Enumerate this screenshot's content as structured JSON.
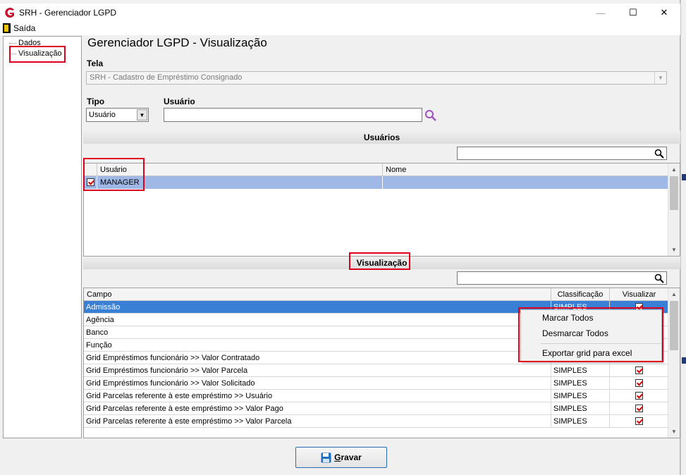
{
  "window": {
    "title": "SRH - Gerenciador LGPD",
    "minimize_glyph": "—",
    "maximize_glyph": "☐",
    "close_glyph": "✕"
  },
  "menu": {
    "exit_label": "Saída",
    "exit_icon": "exit-door-icon"
  },
  "tree": {
    "items": [
      {
        "label": "Dados"
      },
      {
        "label": "Visualização"
      }
    ]
  },
  "page": {
    "title": "Gerenciador LGPD - Visualização"
  },
  "tela": {
    "label": "Tela",
    "value": "SRH - Cadastro de Empréstimo Consignado"
  },
  "tipo": {
    "label": "Tipo",
    "value": "Usuário"
  },
  "usuario": {
    "label": "Usuário",
    "value": "",
    "search_icon": "search-icon",
    "search_color": "#a04fc0"
  },
  "users_section": {
    "title": "Usuários",
    "filter_value": "",
    "headers": {
      "user": "Usuário",
      "nome": "Nome"
    },
    "rows": [
      {
        "checked": true,
        "user": "MANAGER",
        "nome": ""
      }
    ]
  },
  "vis_section": {
    "title": "Visualização",
    "filter_value": "",
    "headers": {
      "campo": "Campo",
      "classificacao": "Classificação",
      "visualizar": "Visualizar"
    },
    "rows": [
      {
        "campo": "Admissão",
        "classificacao": "SIMPLES",
        "visualizar": true,
        "selected": true
      },
      {
        "campo": "Agência",
        "classificacao": "",
        "visualizar": true,
        "selected": false
      },
      {
        "campo": "Banco",
        "classificacao": "",
        "visualizar": true,
        "selected": false
      },
      {
        "campo": "Função",
        "classificacao": "",
        "visualizar": true,
        "selected": false
      },
      {
        "campo": "Grid Empréstimos funcionário >> Valor Contratado",
        "classificacao": "",
        "visualizar": true,
        "selected": false
      },
      {
        "campo": "Grid Empréstimos funcionário >> Valor Parcela",
        "classificacao": "SIMPLES",
        "visualizar": true,
        "selected": false
      },
      {
        "campo": "Grid Empréstimos funcionário >> Valor Solicitado",
        "classificacao": "SIMPLES",
        "visualizar": true,
        "selected": false
      },
      {
        "campo": "Grid Parcelas referente à este empréstimo >> Usuário",
        "classificacao": "SIMPLES",
        "visualizar": true,
        "selected": false
      },
      {
        "campo": "Grid Parcelas referente à este empréstimo >> Valor Pago",
        "classificacao": "SIMPLES",
        "visualizar": true,
        "selected": false
      },
      {
        "campo": "Grid Parcelas referente à este empréstimo >> Valor Parcela",
        "classificacao": "SIMPLES",
        "visualizar": true,
        "selected": false
      }
    ]
  },
  "context_menu": {
    "items": [
      "Marcar Todos",
      "Desmarcar Todos",
      "Exportar grid para excel"
    ]
  },
  "save": {
    "label_underlined": "G",
    "label_rest": "ravar",
    "icon": "floppy-disk-icon"
  },
  "colors": {
    "highlight": "#e0001b",
    "selected_row": "#3a7fd6",
    "users_selected_row": "#9fb8e6",
    "check_red": "#d40000"
  }
}
